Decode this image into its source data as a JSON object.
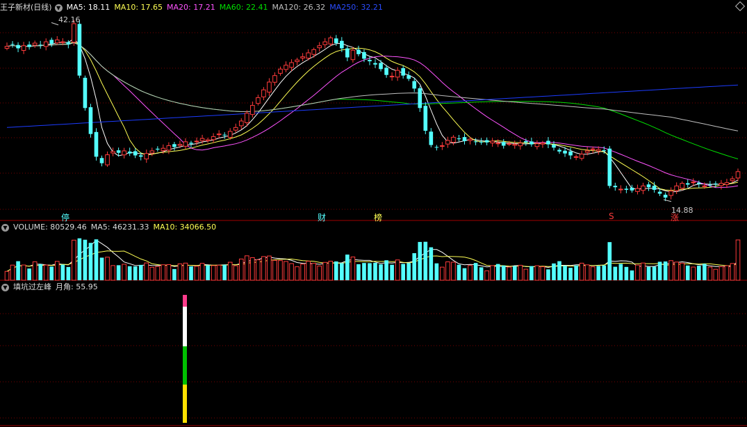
{
  "header_main": {
    "stock": "王子新材(日线)",
    "ma5": "MA5: 18.11",
    "ma10": "MA10: 17.65",
    "ma20": "MA20: 17.21",
    "ma60": "MA60: 22.41",
    "ma120": "MA120: 26.32",
    "ma250": "MA250: 32.21"
  },
  "header_volume": {
    "vol": "VOLUME: 80529.46",
    "ma5": "MA5: 46231.33",
    "ma10": "MA10: 34066.50"
  },
  "header_indicator": {
    "name": "填坑过左峰",
    "value": "月角: 55.95"
  },
  "markers": {
    "high_label": "42.16",
    "low_label": "14.88",
    "tag_ting": "停",
    "tag_cai": "财",
    "tag_bang": "榜",
    "tag_s": "S",
    "tag_zhang": "涨"
  },
  "colors": {
    "up": "#ff3b3b",
    "down": "#54ffff",
    "ma5": "#ffffff",
    "ma10": "#ffff54",
    "ma20": "#ff54ff",
    "ma60": "#00e000",
    "ma120": "#c0c0c0",
    "ma250": "#1c3cff",
    "grid": "#7a0000"
  },
  "chart_data": {
    "type": "candlestick",
    "ma_latest": {
      "ma5": 18.11,
      "ma10": 17.65,
      "ma20": 17.21,
      "ma60": 22.41,
      "ma120": 26.32,
      "ma250": 32.21
    },
    "price_high": 42.16,
    "price_low": 14.88,
    "close_series": [
      38.5,
      38.8,
      38.2,
      38.6,
      38.4,
      39.0,
      38.7,
      39.2,
      38.9,
      39.5,
      39.2,
      38.8,
      42.0,
      34.0,
      29.0,
      25.0,
      21.5,
      20.5,
      21.8,
      22.3,
      22.1,
      22.4,
      22.0,
      21.7,
      21.5,
      22.0,
      22.4,
      22.6,
      22.8,
      23.2,
      23.0,
      23.4,
      23.8,
      23.5,
      23.9,
      24.3,
      24.1,
      24.6,
      25.0,
      24.8,
      25.4,
      26.0,
      27.0,
      28.2,
      29.4,
      30.6,
      31.8,
      33.0,
      34.0,
      35.0,
      35.6,
      36.0,
      36.4,
      36.9,
      37.5,
      38.0,
      38.6,
      39.2,
      39.8,
      39.0,
      38.2,
      36.8,
      37.9,
      37.3,
      36.6,
      36.2,
      35.7,
      35.0,
      34.1,
      33.9,
      34.8,
      34.0,
      33.5,
      32.0,
      29.0,
      25.5,
      23.3,
      22.9,
      23.2,
      24.0,
      24.5,
      24.2,
      23.9,
      24.2,
      23.8,
      23.7,
      23.7,
      23.9,
      23.6,
      23.2,
      23.5,
      23.4,
      23.6,
      23.7,
      23.4,
      23.5,
      23.6,
      23.4,
      22.9,
      22.3,
      22.0,
      21.7,
      21.5,
      21.9,
      22.4,
      22.7,
      22.6,
      22.4,
      17.0,
      16.8,
      16.5,
      16.4,
      16.3,
      16.6,
      17.0,
      16.8,
      16.4,
      15.8,
      15.2,
      16.2,
      17.0,
      17.4,
      17.2,
      17.6,
      17.3,
      17.0,
      17.1,
      17.3,
      17.4,
      17.5,
      18.1,
      19.2
    ],
    "volume": {
      "latest": 80529.46,
      "ma5": 46231.33,
      "ma10": 34066.5
    },
    "indicator": {
      "name": "填坑过左峰",
      "月角": 55.95,
      "bar_colors": [
        "#ff3c8c",
        "#ffffff",
        "#00c000",
        "#ffe000"
      ]
    }
  }
}
